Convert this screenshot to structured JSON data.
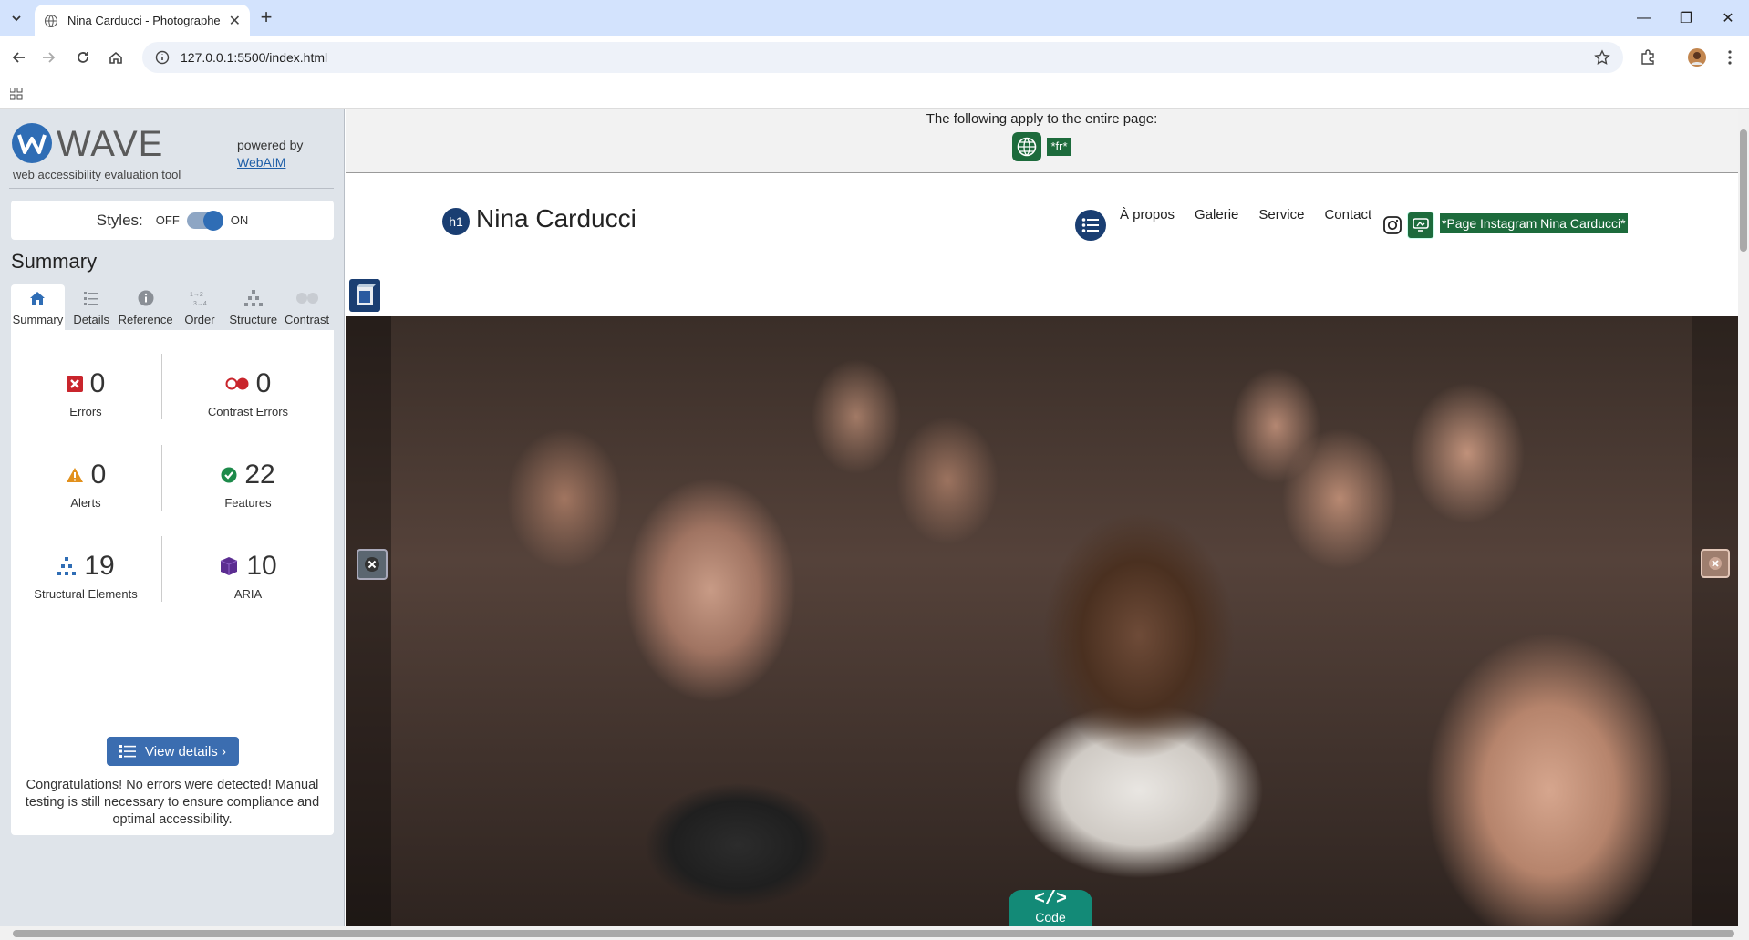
{
  "browser": {
    "tab_title": "Nina Carducci - Photographe p",
    "url": "127.0.0.1:5500/index.html"
  },
  "wave": {
    "brand": "WAVE",
    "tagline": "web accessibility evaluation tool",
    "powered_by": "powered by",
    "webaim": "WebAIM",
    "styles_label": "Styles:",
    "styles_off": "OFF",
    "styles_on": "ON",
    "summary_heading": "Summary",
    "tabs": [
      {
        "label": "Summary",
        "icon": "home-icon"
      },
      {
        "label": "Details",
        "icon": "list-icon"
      },
      {
        "label": "Reference",
        "icon": "info-icon"
      },
      {
        "label": "Order",
        "icon": "order-icon"
      },
      {
        "label": "Structure",
        "icon": "structure-icon"
      },
      {
        "label": "Contrast",
        "icon": "contrast-icon"
      }
    ],
    "stats": {
      "errors": {
        "value": "0",
        "label": "Errors"
      },
      "contrast_errors": {
        "value": "0",
        "label": "Contrast Errors"
      },
      "alerts": {
        "value": "0",
        "label": "Alerts"
      },
      "features": {
        "value": "22",
        "label": "Features"
      },
      "structural": {
        "value": "19",
        "label": "Structural Elements"
      },
      "aria": {
        "value": "10",
        "label": "ARIA"
      }
    },
    "view_details": "View details ›",
    "congrats": "Congratulations! No errors were detected! Manual testing is still necessary to ensure compliance and optimal accessibility."
  },
  "page": {
    "apply_text": "The following apply to the entire page:",
    "lang_badge": "*fr*",
    "h1_badge": "h1",
    "site_title": "Nina Carducci",
    "nav": [
      "À propos",
      "Galerie",
      "Service",
      "Contact"
    ],
    "instagram_label": "*Page Instagram Nina Carducci*",
    "code_label": "Code",
    "code_symbol": "</>"
  },
  "colors": {
    "wave_blue": "#2f6db5",
    "feature_green": "#1d6b3c",
    "aria_navy": "#1a3e72",
    "code_teal": "#138a77"
  }
}
